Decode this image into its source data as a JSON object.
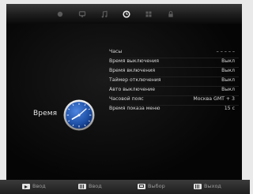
{
  "tabs": [
    {
      "icon": "picture-icon",
      "selected": false
    },
    {
      "icon": "monitor-icon",
      "selected": false
    },
    {
      "icon": "music-note-icon",
      "selected": false
    },
    {
      "icon": "clock-icon",
      "selected": true
    },
    {
      "icon": "grid-icon",
      "selected": false
    },
    {
      "icon": "lock-icon",
      "selected": false
    }
  ],
  "category": {
    "label": "Время",
    "icon": "clock-icon"
  },
  "menu": {
    "items": [
      {
        "label": "Часы",
        "value": "– – – – –"
      },
      {
        "label": "Время выключения",
        "value": "Выкл"
      },
      {
        "label": "Время включения",
        "value": "Выкл"
      },
      {
        "label": "Таймер отключения",
        "value": "Выкл"
      },
      {
        "label": "Авто выключение",
        "value": "Выкл"
      },
      {
        "label": "Часовой пояс",
        "value": "Москва GMT + 3"
      },
      {
        "label": "Время показа меню",
        "value": "15 с"
      }
    ]
  },
  "footer": {
    "hints": [
      {
        "icon": "enter-button-icon",
        "label": "Ввод"
      },
      {
        "icon": "ok-button-icon",
        "label": "Ввод"
      },
      {
        "icon": "select-button-icon",
        "label": "Выбор"
      },
      {
        "icon": "exit-button-icon",
        "label": "Выход"
      }
    ]
  },
  "colors": {
    "background": "#000000",
    "text": "#d8d8d8",
    "clock_face": "#2a5fb8",
    "page_bg": "#e9e9e9"
  }
}
